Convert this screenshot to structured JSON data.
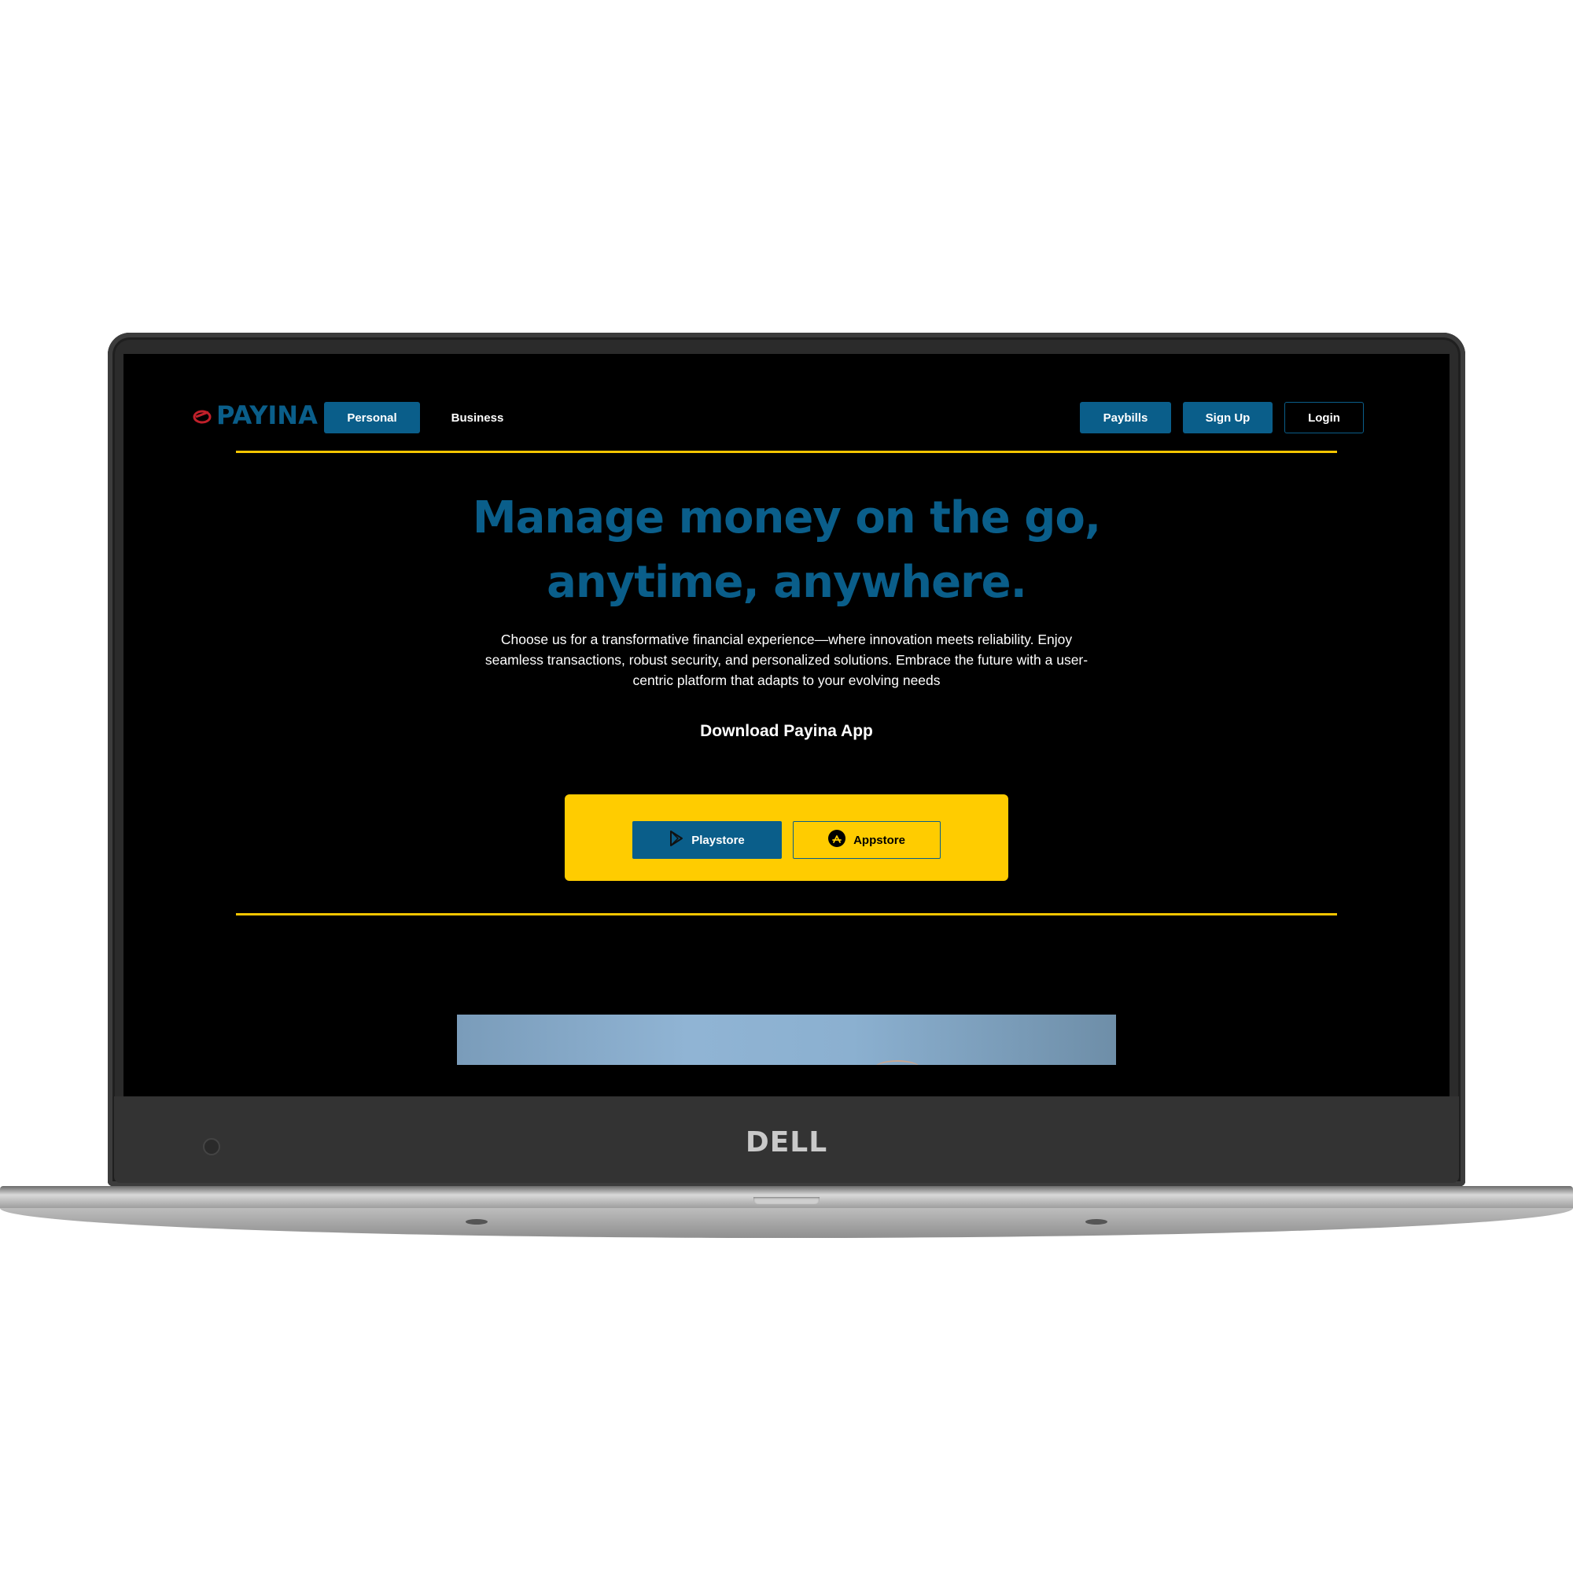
{
  "site": {
    "logo_text": "PAYINA",
    "nav": {
      "personal": "Personal",
      "business": "Business",
      "paybills": "Paybills",
      "signup": "Sign Up",
      "login": "Login"
    },
    "hero": {
      "title_line1": "Manage money on the go,",
      "title_line2": "anytime, anywhere.",
      "description": "Choose us for a transformative financial experience—where innovation meets reliability. Enjoy seamless transactions, robust security, and personalized solutions. Embrace the future with a user-centric platform that adapts to your evolving needs"
    },
    "download": {
      "title": "Download Payina App",
      "playstore": "Playstore",
      "appstore": "Appstore"
    }
  },
  "device": {
    "brand": "DELL"
  },
  "colors": {
    "primary": "#0a5e8a",
    "accent": "#ffcc00",
    "rule": "#f6c500",
    "logo_mark": "#c0202a",
    "background": "#000000"
  },
  "icons": {
    "logo": "payina-logo-icon",
    "playstore": "play-store-icon",
    "appstore": "app-store-icon",
    "webcam": "webcam-icon"
  }
}
